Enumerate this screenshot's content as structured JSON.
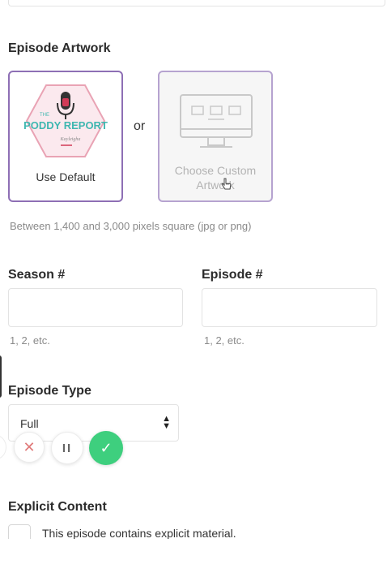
{
  "episode_artwork": {
    "heading": "Episode Artwork",
    "default_card": {
      "label": "Use Default",
      "logo_small_text": "THE",
      "logo_title": "PODDY REPORT",
      "logo_subtitle": "Kayleigha"
    },
    "or_label": "or",
    "custom_card": {
      "label": "Choose Custom Artwork"
    },
    "hint": "Between 1,400 and 3,000 pixels square (jpg or png)"
  },
  "season": {
    "label": "Season #",
    "value": "",
    "hint": "1, 2, etc."
  },
  "episode_number": {
    "label": "Episode #",
    "value": "",
    "hint": "1, 2, etc."
  },
  "episode_type": {
    "label": "Episode Type",
    "selected": "Full"
  },
  "recording_controls": {
    "cancel_icon": "close-icon",
    "pause_icon": "pause-icon",
    "confirm_icon": "check-icon",
    "pause_glyph": "II"
  },
  "explicit_content": {
    "heading": "Explicit Content",
    "checkbox_label": "This episode contains explicit material.",
    "checked": false
  },
  "colors": {
    "accent_purple": "#8e6fb5",
    "confirm_green": "#3ecf7e",
    "cancel_red": "#e07a7a",
    "logo_pink": "#e9a3b4",
    "logo_teal": "#3fb7b0"
  }
}
